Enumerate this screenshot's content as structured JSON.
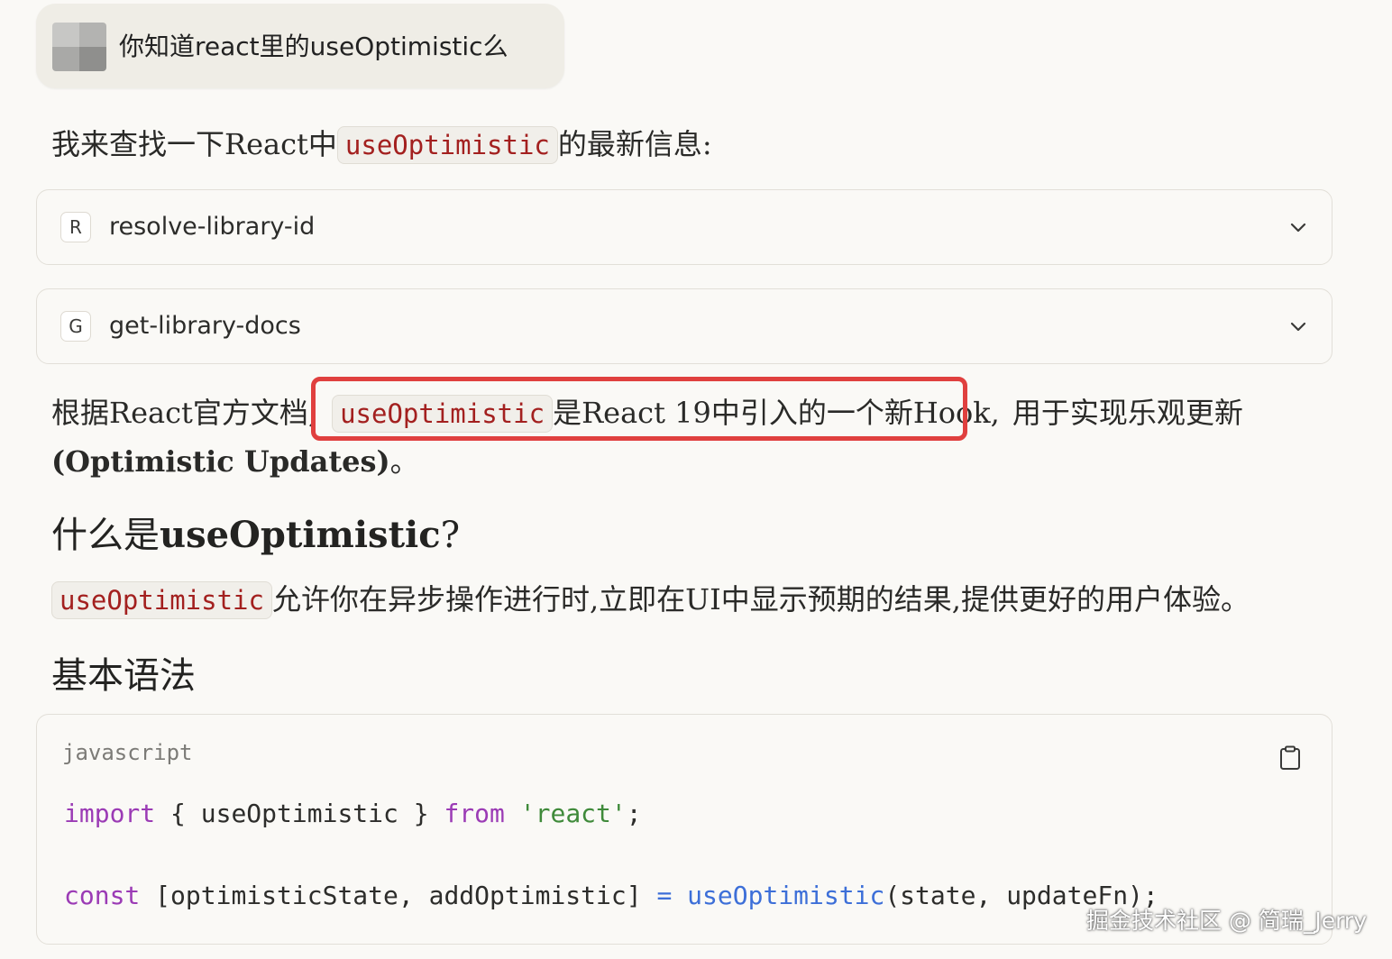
{
  "user_message": {
    "text": "你知道react里的useOptimistic么"
  },
  "intro": {
    "prefix": "我来查找一下React中",
    "code": "useOptimistic",
    "suffix": "的最新信息:"
  },
  "tools": [
    {
      "badge": "R",
      "name": "resolve-library-id"
    },
    {
      "badge": "G",
      "name": "get-library-docs"
    }
  ],
  "paragraph1": {
    "prefix": "根据React官方文档,",
    "code": "useOptimistic",
    "highlighted": "是React 19中引入的一个新Hook,",
    "suffix": "用于实现乐观更新",
    "line2_bold": "(Optimistic Updates)",
    "line2_end": "。"
  },
  "heading1": {
    "prefix": "什么是",
    "bold": "useOptimistic",
    "suffix": "?"
  },
  "paragraph2": {
    "code": "useOptimistic",
    "text": "允许你在异步操作进行时,立即在UI中显示预期的结果,提供更好的用户体验。"
  },
  "heading2": {
    "text": "基本语法"
  },
  "code_block": {
    "language": "javascript",
    "line1": {
      "kw_import": "import",
      "middle": " { useOptimistic } ",
      "kw_from": "from",
      "space": " ",
      "str": "'react'",
      "end": ";"
    },
    "line2": {
      "kw_const": "const",
      "middle": " [optimisticState, addOptimistic] ",
      "op": "=",
      "space": " ",
      "fn": "useOptimistic",
      "args": "(state, updateFn);"
    }
  },
  "watermark": {
    "text": "掘金技术社区 @ 简瑞_Jerry"
  },
  "colors": {
    "background": "#faf9f6",
    "user_bubble": "#efede6",
    "inline_code_text": "#a3201f",
    "highlight_border": "#e0403f",
    "keyword": "#9b3bb5",
    "string": "#3f8a3a",
    "function": "#3d6fd8"
  },
  "icons": {
    "chevron": "chevron-down-icon",
    "copy": "clipboard-copy-icon"
  }
}
